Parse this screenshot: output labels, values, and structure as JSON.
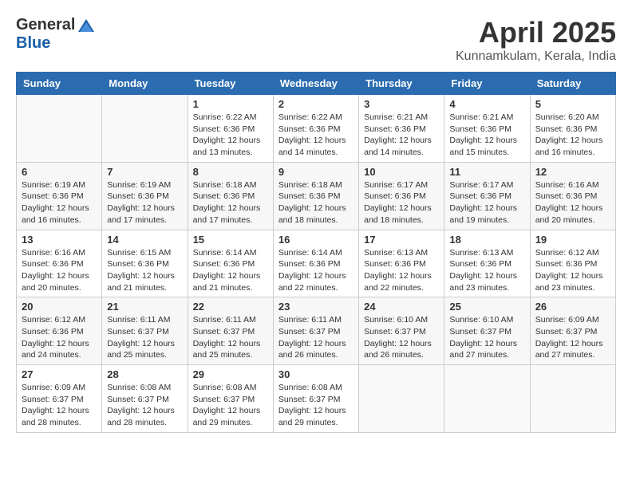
{
  "logo": {
    "general": "General",
    "blue": "Blue"
  },
  "title": "April 2025",
  "location": "Kunnamkulam, Kerala, India",
  "days_of_week": [
    "Sunday",
    "Monday",
    "Tuesday",
    "Wednesday",
    "Thursday",
    "Friday",
    "Saturday"
  ],
  "weeks": [
    [
      {
        "day": "",
        "info": ""
      },
      {
        "day": "",
        "info": ""
      },
      {
        "day": "1",
        "info": "Sunrise: 6:22 AM\nSunset: 6:36 PM\nDaylight: 12 hours and 13 minutes."
      },
      {
        "day": "2",
        "info": "Sunrise: 6:22 AM\nSunset: 6:36 PM\nDaylight: 12 hours and 14 minutes."
      },
      {
        "day": "3",
        "info": "Sunrise: 6:21 AM\nSunset: 6:36 PM\nDaylight: 12 hours and 14 minutes."
      },
      {
        "day": "4",
        "info": "Sunrise: 6:21 AM\nSunset: 6:36 PM\nDaylight: 12 hours and 15 minutes."
      },
      {
        "day": "5",
        "info": "Sunrise: 6:20 AM\nSunset: 6:36 PM\nDaylight: 12 hours and 16 minutes."
      }
    ],
    [
      {
        "day": "6",
        "info": "Sunrise: 6:19 AM\nSunset: 6:36 PM\nDaylight: 12 hours and 16 minutes."
      },
      {
        "day": "7",
        "info": "Sunrise: 6:19 AM\nSunset: 6:36 PM\nDaylight: 12 hours and 17 minutes."
      },
      {
        "day": "8",
        "info": "Sunrise: 6:18 AM\nSunset: 6:36 PM\nDaylight: 12 hours and 17 minutes."
      },
      {
        "day": "9",
        "info": "Sunrise: 6:18 AM\nSunset: 6:36 PM\nDaylight: 12 hours and 18 minutes."
      },
      {
        "day": "10",
        "info": "Sunrise: 6:17 AM\nSunset: 6:36 PM\nDaylight: 12 hours and 18 minutes."
      },
      {
        "day": "11",
        "info": "Sunrise: 6:17 AM\nSunset: 6:36 PM\nDaylight: 12 hours and 19 minutes."
      },
      {
        "day": "12",
        "info": "Sunrise: 6:16 AM\nSunset: 6:36 PM\nDaylight: 12 hours and 20 minutes."
      }
    ],
    [
      {
        "day": "13",
        "info": "Sunrise: 6:16 AM\nSunset: 6:36 PM\nDaylight: 12 hours and 20 minutes."
      },
      {
        "day": "14",
        "info": "Sunrise: 6:15 AM\nSunset: 6:36 PM\nDaylight: 12 hours and 21 minutes."
      },
      {
        "day": "15",
        "info": "Sunrise: 6:14 AM\nSunset: 6:36 PM\nDaylight: 12 hours and 21 minutes."
      },
      {
        "day": "16",
        "info": "Sunrise: 6:14 AM\nSunset: 6:36 PM\nDaylight: 12 hours and 22 minutes."
      },
      {
        "day": "17",
        "info": "Sunrise: 6:13 AM\nSunset: 6:36 PM\nDaylight: 12 hours and 22 minutes."
      },
      {
        "day": "18",
        "info": "Sunrise: 6:13 AM\nSunset: 6:36 PM\nDaylight: 12 hours and 23 minutes."
      },
      {
        "day": "19",
        "info": "Sunrise: 6:12 AM\nSunset: 6:36 PM\nDaylight: 12 hours and 23 minutes."
      }
    ],
    [
      {
        "day": "20",
        "info": "Sunrise: 6:12 AM\nSunset: 6:36 PM\nDaylight: 12 hours and 24 minutes."
      },
      {
        "day": "21",
        "info": "Sunrise: 6:11 AM\nSunset: 6:37 PM\nDaylight: 12 hours and 25 minutes."
      },
      {
        "day": "22",
        "info": "Sunrise: 6:11 AM\nSunset: 6:37 PM\nDaylight: 12 hours and 25 minutes."
      },
      {
        "day": "23",
        "info": "Sunrise: 6:11 AM\nSunset: 6:37 PM\nDaylight: 12 hours and 26 minutes."
      },
      {
        "day": "24",
        "info": "Sunrise: 6:10 AM\nSunset: 6:37 PM\nDaylight: 12 hours and 26 minutes."
      },
      {
        "day": "25",
        "info": "Sunrise: 6:10 AM\nSunset: 6:37 PM\nDaylight: 12 hours and 27 minutes."
      },
      {
        "day": "26",
        "info": "Sunrise: 6:09 AM\nSunset: 6:37 PM\nDaylight: 12 hours and 27 minutes."
      }
    ],
    [
      {
        "day": "27",
        "info": "Sunrise: 6:09 AM\nSunset: 6:37 PM\nDaylight: 12 hours and 28 minutes."
      },
      {
        "day": "28",
        "info": "Sunrise: 6:08 AM\nSunset: 6:37 PM\nDaylight: 12 hours and 28 minutes."
      },
      {
        "day": "29",
        "info": "Sunrise: 6:08 AM\nSunset: 6:37 PM\nDaylight: 12 hours and 29 minutes."
      },
      {
        "day": "30",
        "info": "Sunrise: 6:08 AM\nSunset: 6:37 PM\nDaylight: 12 hours and 29 minutes."
      },
      {
        "day": "",
        "info": ""
      },
      {
        "day": "",
        "info": ""
      },
      {
        "day": "",
        "info": ""
      }
    ]
  ]
}
